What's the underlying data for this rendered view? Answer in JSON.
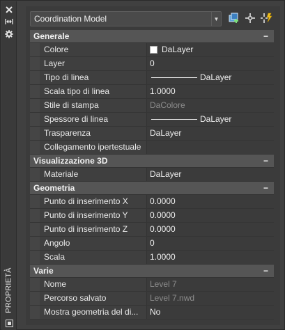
{
  "panel_title": "PROPRIETÀ",
  "selector": {
    "value": "Coordination Model"
  },
  "sections": [
    {
      "title": "Generale",
      "rows": [
        {
          "name": "Colore",
          "value": "DaLayer",
          "kind": "swatch"
        },
        {
          "name": "Layer",
          "value": "0"
        },
        {
          "name": "Tipo di linea",
          "value": "DaLayer",
          "kind": "line"
        },
        {
          "name": "Scala tipo di linea",
          "value": "1.0000"
        },
        {
          "name": "Stile di stampa",
          "value": "DaColore",
          "dim": true
        },
        {
          "name": "Spessore di linea",
          "value": "DaLayer",
          "kind": "line"
        },
        {
          "name": "Trasparenza",
          "value": "DaLayer"
        },
        {
          "name": "Collegamento ipertestuale",
          "value": ""
        }
      ]
    },
    {
      "title": "Visualizzazione 3D",
      "rows": [
        {
          "name": "Materiale",
          "value": "DaLayer"
        }
      ]
    },
    {
      "title": "Geometria",
      "rows": [
        {
          "name": "Punto di inserimento X",
          "value": "0.0000"
        },
        {
          "name": "Punto di inserimento Y",
          "value": "0.0000"
        },
        {
          "name": "Punto di inserimento Z",
          "value": "0.0000"
        },
        {
          "name": "Angolo",
          "value": "0"
        },
        {
          "name": "Scala",
          "value": "1.0000"
        }
      ]
    },
    {
      "title": "Varie",
      "rows": [
        {
          "name": "Nome",
          "value": "Level 7",
          "dim": true
        },
        {
          "name": "Percorso salvato",
          "value": "Level 7.nwd",
          "dim": true
        },
        {
          "name": "Mostra geometria del di...",
          "value": "No"
        }
      ]
    }
  ],
  "collapse_glyph": "−"
}
